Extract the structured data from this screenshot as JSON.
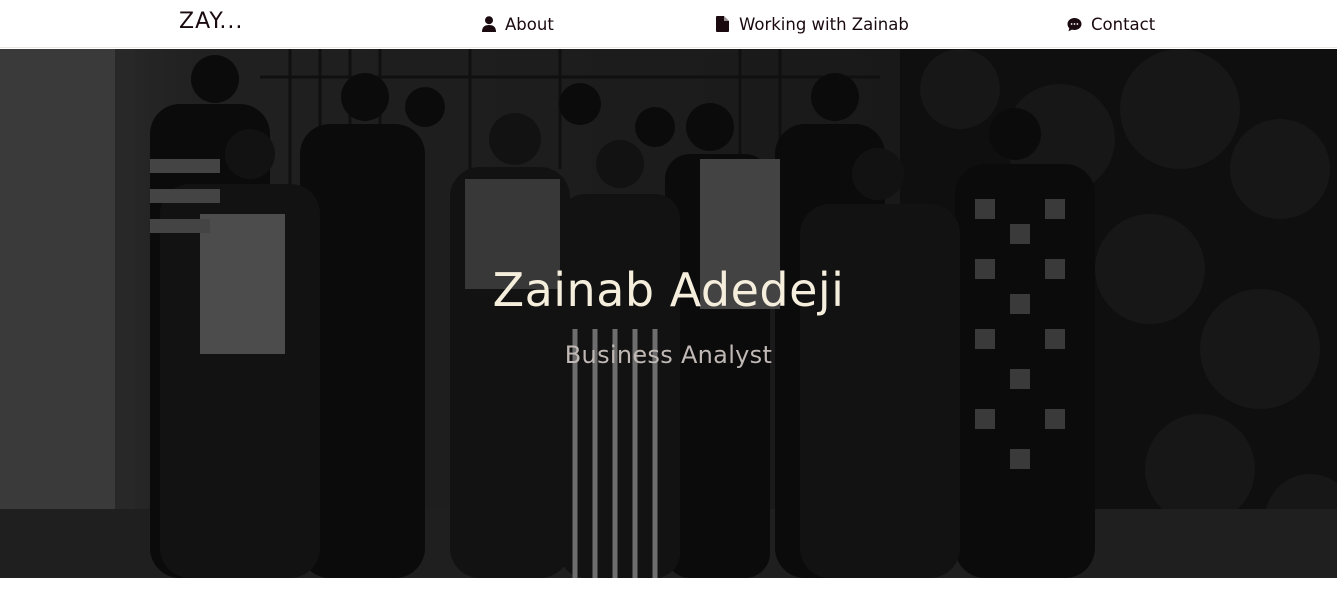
{
  "navbar": {
    "brand": "ZAY...",
    "links": [
      {
        "label": "About",
        "icon": "user-icon"
      },
      {
        "label": "Working with Zainab",
        "icon": "document-icon"
      },
      {
        "label": "Contact",
        "icon": "chat-bubble-icon"
      }
    ]
  },
  "hero": {
    "title": "Zainab Adedeji",
    "subtitle": "Business Analyst",
    "background": "team-group-photo"
  },
  "colors": {
    "nav_background": "#ffffff",
    "nav_text": "#1a0a10",
    "hero_title": "#f5eedd",
    "hero_subtitle": "#bfb8b4"
  }
}
